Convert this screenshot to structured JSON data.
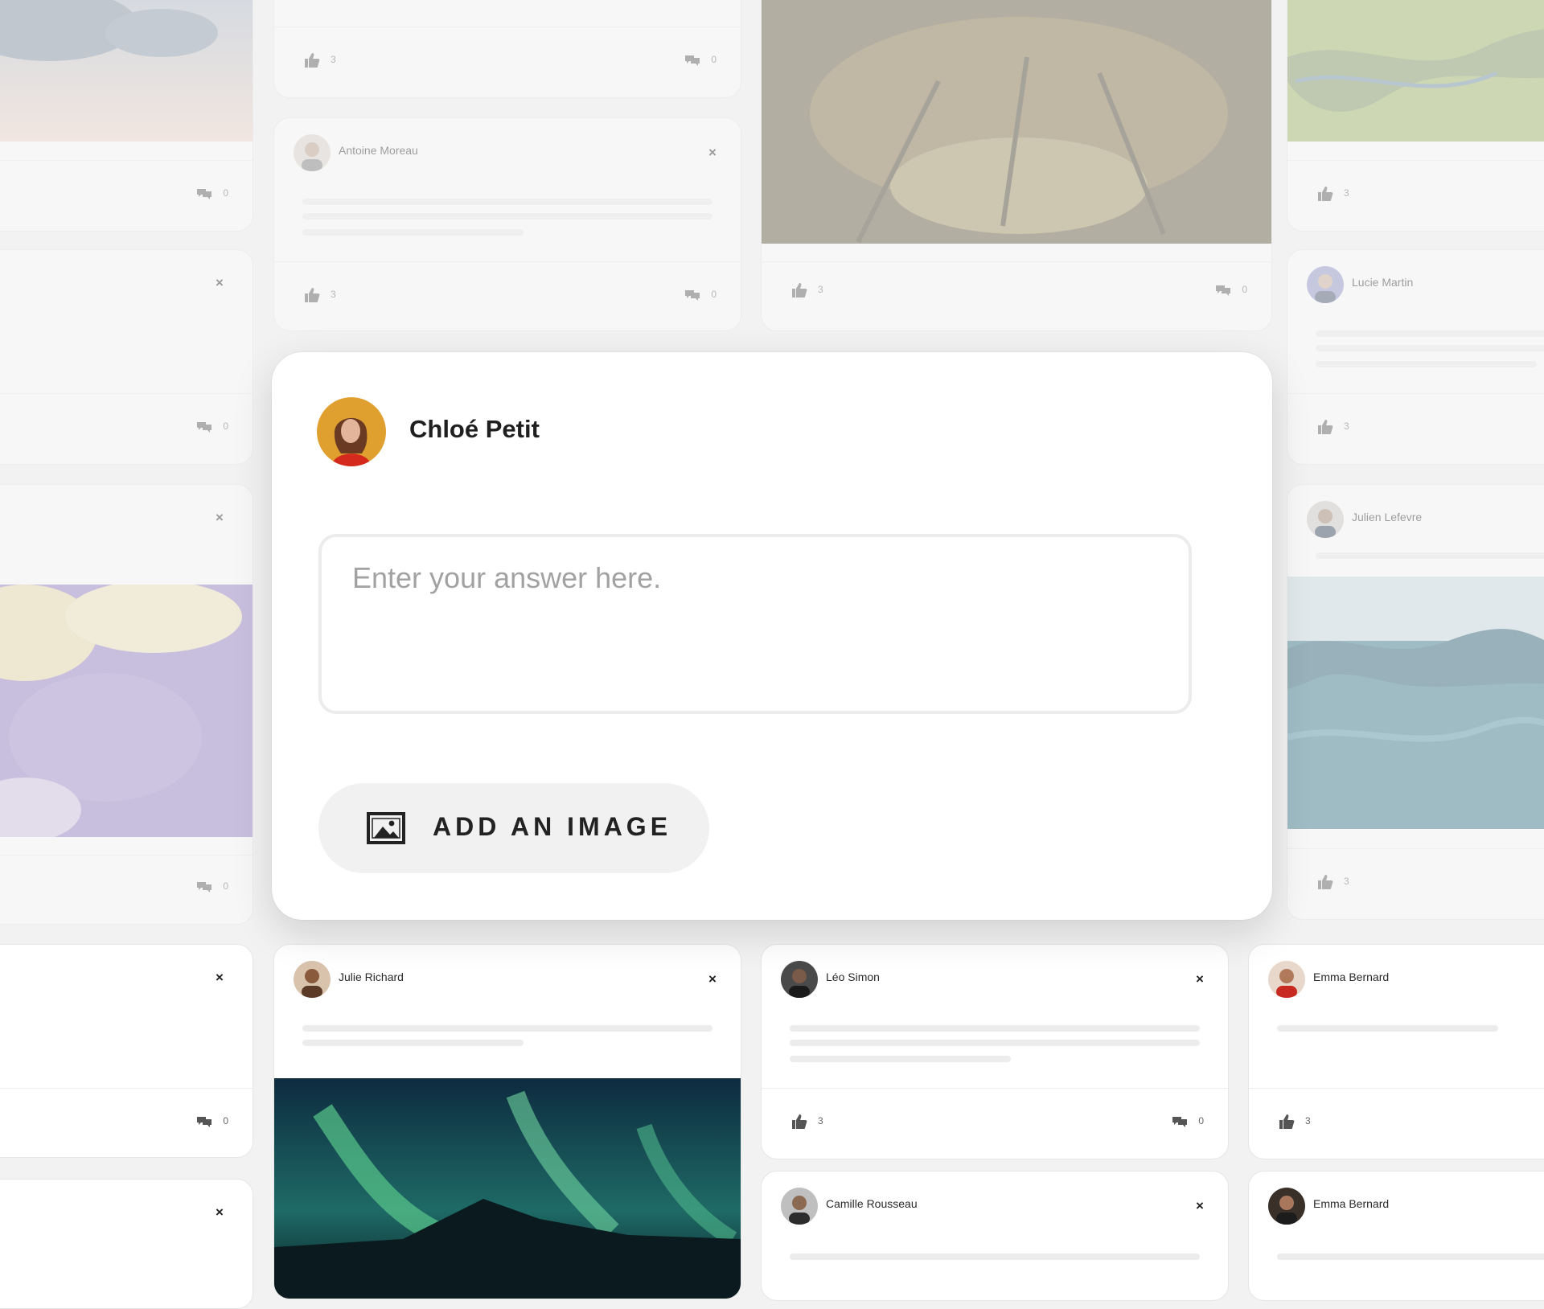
{
  "composer": {
    "user_name": "Chloé Petit",
    "answer_placeholder": "Enter your answer here.",
    "add_image_label": "ADD AN IMAGE"
  },
  "feed_cards": [
    {
      "name": "Antoine Moreau",
      "likes": "3",
      "comments": "0"
    },
    {
      "name": "Lucie Martin",
      "likes": "3"
    },
    {
      "name": "Julien Lefevre",
      "likes": "3"
    },
    {
      "name": "Julie Richard"
    },
    {
      "name": "Léo Simon",
      "likes": "3",
      "comments": "0"
    },
    {
      "name": "Emma Bernard",
      "likes": "3"
    },
    {
      "name": "Camille Rousseau"
    },
    {
      "name": "Emma Bernard"
    }
  ],
  "partial_cards": {
    "top_likes": "3",
    "top_comments": "0",
    "forest_likes": "3",
    "forest_comments": "0",
    "left_comments": [
      "0",
      "0",
      "0",
      "0"
    ],
    "close_symbol": "×"
  },
  "icons": [
    "thumbs-up-icon",
    "comment-icon",
    "close-icon",
    "image-icon"
  ]
}
